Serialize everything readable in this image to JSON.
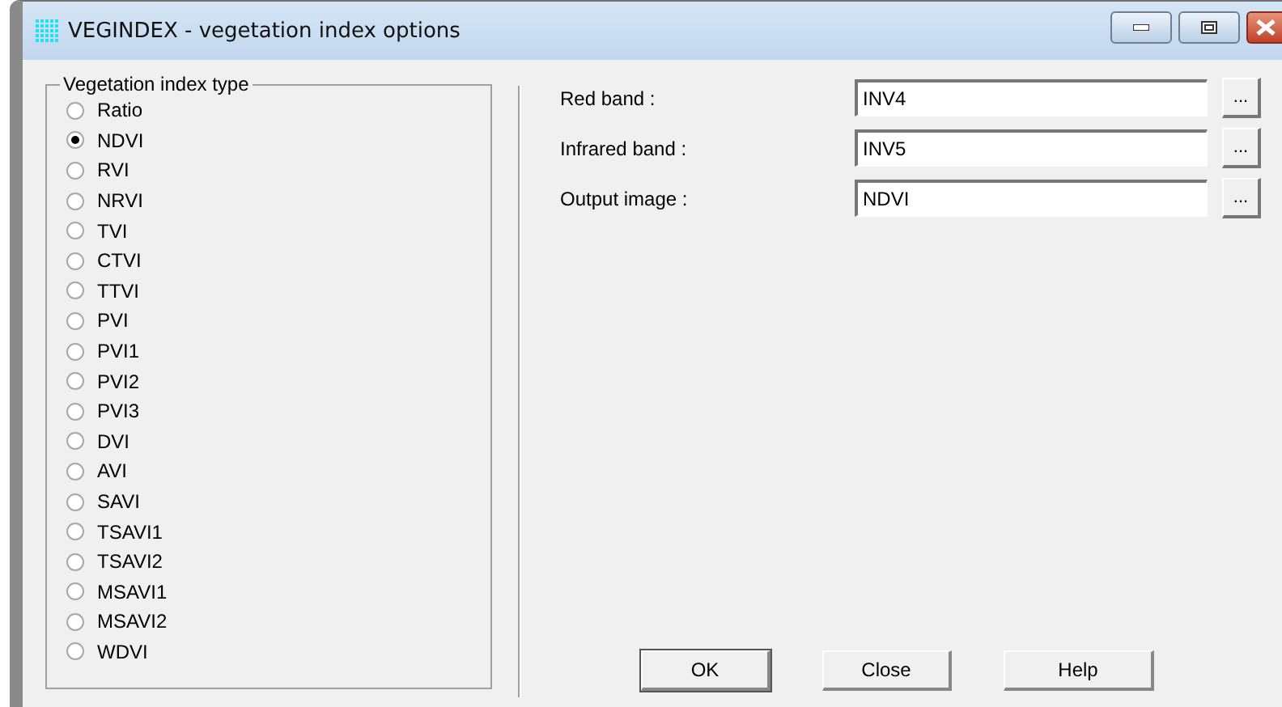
{
  "window": {
    "title": "VEGINDEX - vegetation index options"
  },
  "index_type": {
    "label": "Vegetation index type",
    "options": [
      {
        "label": "Ratio",
        "selected": false
      },
      {
        "label": "NDVI",
        "selected": true
      },
      {
        "label": "RVI",
        "selected": false
      },
      {
        "label": "NRVI",
        "selected": false
      },
      {
        "label": "TVI",
        "selected": false
      },
      {
        "label": "CTVI",
        "selected": false
      },
      {
        "label": "TTVI",
        "selected": false
      },
      {
        "label": "PVI",
        "selected": false
      },
      {
        "label": "PVI1",
        "selected": false
      },
      {
        "label": "PVI2",
        "selected": false
      },
      {
        "label": "PVI3",
        "selected": false
      },
      {
        "label": "DVI",
        "selected": false
      },
      {
        "label": "AVI",
        "selected": false
      },
      {
        "label": "SAVI",
        "selected": false
      },
      {
        "label": "TSAVI1",
        "selected": false
      },
      {
        "label": "TSAVI2",
        "selected": false
      },
      {
        "label": "MSAVI1",
        "selected": false
      },
      {
        "label": "MSAVI2",
        "selected": false
      },
      {
        "label": "WDVI",
        "selected": false
      }
    ]
  },
  "fields": [
    {
      "label": "Red band :",
      "value": "INV4",
      "browse": "..."
    },
    {
      "label": "Infrared band :",
      "value": "INV5",
      "browse": "..."
    },
    {
      "label": "Output image :",
      "value": "NDVI",
      "browse": "..."
    }
  ],
  "buttons": [
    {
      "label": "OK",
      "default": true
    },
    {
      "label": "Close",
      "default": false
    },
    {
      "label": "Help",
      "default": false
    }
  ]
}
